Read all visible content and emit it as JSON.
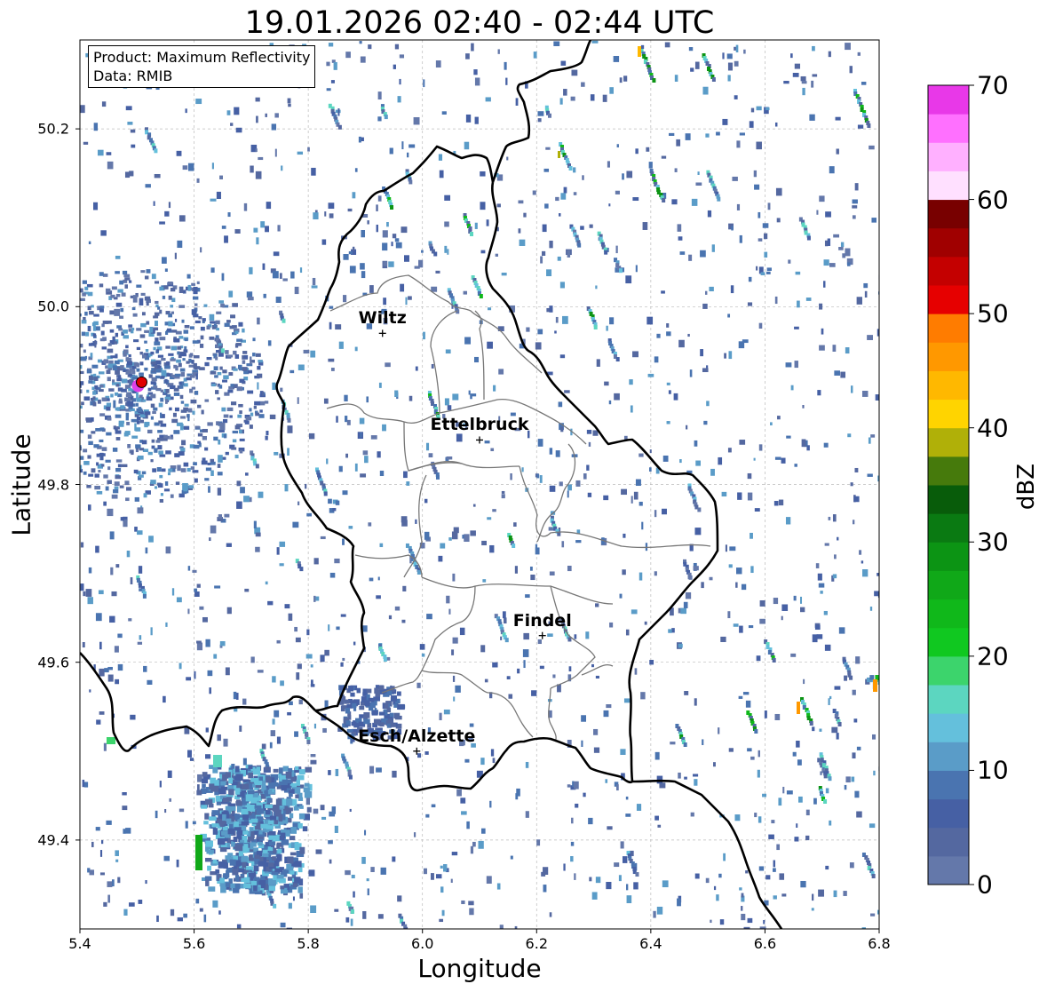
{
  "title": "19.01.2026 02:40 - 02:44 UTC",
  "info_box": {
    "product": "Product: Maximum Reflectivity",
    "data": "Data: RMIB"
  },
  "xlabel": "Longitude",
  "ylabel": "Latitude",
  "colorbar": {
    "label": "dBZ",
    "ticks": [
      "0",
      "10",
      "20",
      "30",
      "40",
      "50",
      "60",
      "70"
    ],
    "min": 0,
    "max": 70,
    "step": 2.5,
    "colors": [
      "#6478aa",
      "#5468a0",
      "#4660a4",
      "#4a74b0",
      "#5a9cc8",
      "#64c0dc",
      "#5cd6c0",
      "#3cd46c",
      "#10c820",
      "#10b81a",
      "#10a818",
      "#0c9414",
      "#0a7a12",
      "#085c0a",
      "#467a0c",
      "#b0b008",
      "#ffd400",
      "#ffb800",
      "#ff9800",
      "#ff7c00",
      "#e60000",
      "#c40000",
      "#a00000",
      "#780000",
      "#ffe0ff",
      "#ffb0ff",
      "#ff70ff",
      "#e838e8"
    ]
  },
  "map": {
    "xlim": [
      5.4,
      6.8
    ],
    "ylim": [
      49.3,
      50.3
    ],
    "x_ticks": [
      "5.4",
      "5.6",
      "5.8",
      "6.0",
      "6.2",
      "6.4",
      "6.6",
      "6.8"
    ],
    "y_ticks": [
      "49.4",
      "49.6",
      "49.8",
      "50.0",
      "50.2"
    ],
    "grid": true
  },
  "cities": [
    {
      "name": "Wiltz",
      "lon": 5.93,
      "lat": 49.97
    },
    {
      "name": "Ettelbruck",
      "lon": 6.1,
      "lat": 49.85
    },
    {
      "name": "Findel",
      "lon": 6.21,
      "lat": 49.63
    },
    {
      "name": "Esch/Alzette",
      "lon": 5.99,
      "lat": 49.5
    }
  ],
  "radar_site": {
    "lon": 5.505,
    "lat": 49.915
  }
}
